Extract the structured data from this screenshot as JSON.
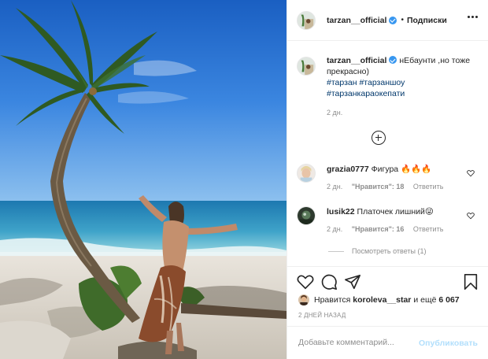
{
  "header": {
    "username": "tarzan__official",
    "separator": "•",
    "follow_label": "Подписки",
    "more_icon": "more-horizontal-icon"
  },
  "caption": {
    "username": "tarzan__official",
    "text": "нЕбаунти ,но тоже прекрасно)",
    "hashtags": [
      "#тарзан",
      "#тарзаншоу",
      "#тарзанкараокепати"
    ],
    "date": "2 дн."
  },
  "load_more_icon": "plus-circle-icon",
  "comments": [
    {
      "username": "grazia0777",
      "text": "Фигура 🔥🔥🔥",
      "date": "2 дн.",
      "likes": "\"Нравится\": 18",
      "reply_label": "Ответить"
    },
    {
      "username": "lusik22",
      "text": "Платочек лишний😜",
      "date": "2 дн.",
      "likes": "\"Нравится\": 16",
      "reply_label": "Ответить"
    }
  ],
  "view_replies_label": "Посмотреть ответы (1)",
  "likes": {
    "prefix": "Нравится",
    "user": "koroleva__star",
    "middle": "и ещё",
    "count": "6 067"
  },
  "posted_ago": "2 ДНЕЙ НАЗАД",
  "add_comment": {
    "placeholder": "Добавьте комментарий...",
    "publish_label": "Опубликовать"
  },
  "colors": {
    "link": "#00376b",
    "verified": "#3897f0",
    "publish_disabled": "#b2dffc",
    "muted": "#8e8e8e"
  }
}
